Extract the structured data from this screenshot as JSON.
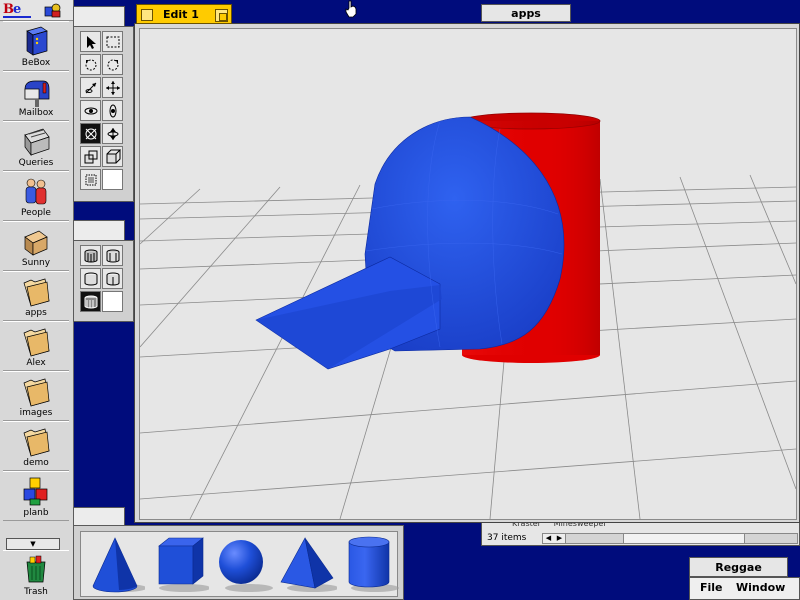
{
  "deskbar": {
    "logo": {
      "b": "B",
      "e": "e"
    },
    "items": [
      {
        "label": "BeBox",
        "icon": "bebox-icon"
      },
      {
        "label": "Mailbox",
        "icon": "mailbox-icon"
      },
      {
        "label": "Queries",
        "icon": "queries-icon"
      },
      {
        "label": "People",
        "icon": "people-icon"
      },
      {
        "label": "Sunny",
        "icon": "home-folder-icon"
      },
      {
        "label": "apps",
        "icon": "folder-icon"
      },
      {
        "label": "Alex",
        "icon": "folder-icon"
      },
      {
        "label": "images",
        "icon": "folder-icon"
      },
      {
        "label": "demo",
        "icon": "folder-icon"
      },
      {
        "label": "planb",
        "icon": "blocks-icon"
      }
    ],
    "collapse": "▼",
    "trash": "Trash"
  },
  "edit_window": {
    "title": "Edit  1"
  },
  "apps_window": {
    "title": "apps",
    "partial_row": "Kraster     Minesweeper",
    "item_count": "37 items"
  },
  "reggae_window": {
    "title": "Reggae",
    "menu": [
      "File",
      "Window"
    ]
  },
  "colors": {
    "desktop": "#000c7c",
    "cap": "#1f4fe0",
    "cylinder": "#e00000",
    "title_active": "#ffcb00",
    "shape_blue": "#1f4fd8"
  },
  "primitives": [
    "cone-icon",
    "cube-icon",
    "sphere-icon",
    "pyramid-icon",
    "cylinder-icon"
  ]
}
